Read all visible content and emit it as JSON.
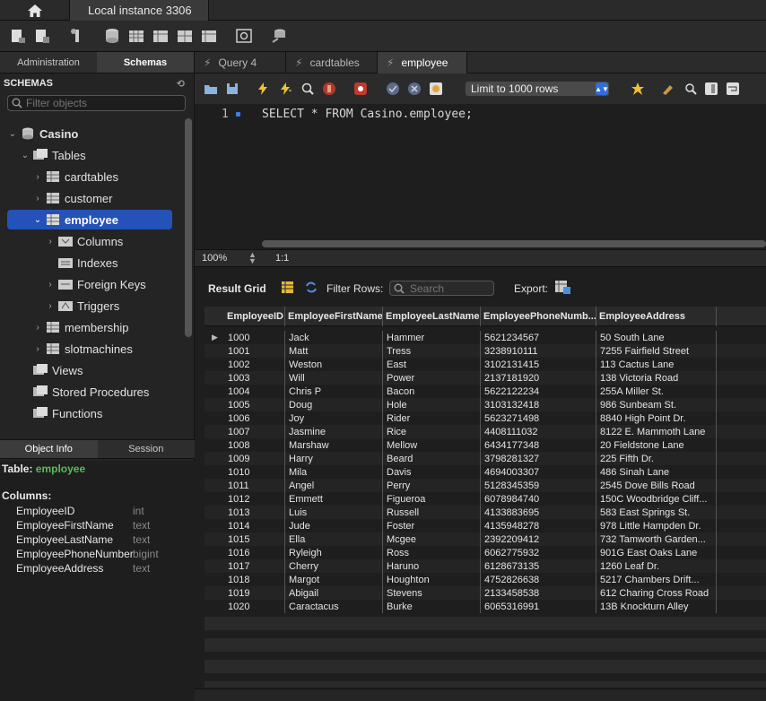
{
  "topbar": {
    "connection_tab": "Local instance 3306"
  },
  "sidebar": {
    "tabs": [
      "Administration",
      "Schemas"
    ],
    "active_tab": "Schemas",
    "header": "SCHEMAS",
    "filter_placeholder": "Filter objects",
    "tree": {
      "schema": "Casino",
      "tables_label": "Tables",
      "tables": [
        "cardtables",
        "customer",
        "employee"
      ],
      "selected_table": "employee",
      "employee_children": [
        "Columns",
        "Indexes",
        "Foreign Keys",
        "Triggers"
      ],
      "more_tables": [
        "membership",
        "slotmachines"
      ],
      "others": [
        "Views",
        "Stored Procedures",
        "Functions"
      ]
    },
    "info_tabs": [
      "Object Info",
      "Session"
    ],
    "object_info": {
      "table_label": "Table:",
      "table_name": "employee",
      "columns_label": "Columns:",
      "columns": [
        {
          "name": "EmployeeID",
          "type": "int"
        },
        {
          "name": "EmployeeFirstName",
          "type": "text"
        },
        {
          "name": "EmployeeLastName",
          "type": "text"
        },
        {
          "name": "EmployeePhoneNumber",
          "type": "bigint"
        },
        {
          "name": "EmployeeAddress",
          "type": "text"
        }
      ]
    }
  },
  "editor_tabs": [
    "Query 4",
    "cardtables",
    "employee"
  ],
  "active_editor_tab": "employee",
  "sql_toolbar": {
    "limit": "Limit to 1000 rows"
  },
  "editor": {
    "line": "1",
    "code": "SELECT * FROM Casino.employee;"
  },
  "status": {
    "zoom": "100%",
    "position": "1:1"
  },
  "result_toolbar": {
    "result_grid": "Result Grid",
    "filter_rows": "Filter Rows:",
    "search_placeholder": "Search",
    "export": "Export:"
  },
  "grid": {
    "columns": [
      "EmployeeID",
      "EmployeeFirstName",
      "EmployeeLastName",
      "EmployeePhoneNumb...",
      "EmployeeAddress"
    ],
    "rows": [
      [
        "1000",
        "Jack",
        "Hammer",
        "5621234567",
        "50 South Lane"
      ],
      [
        "1001",
        "Matt",
        "Tress",
        "3238910111",
        "7255 Fairfield Street"
      ],
      [
        "1002",
        "Weston",
        "East",
        "3102131415",
        "113 Cactus Lane"
      ],
      [
        "1003",
        "Will",
        "Power",
        "2137181920",
        "138 Victoria Road"
      ],
      [
        "1004",
        "Chris P",
        "Bacon",
        "5622122234",
        "255A Miller St."
      ],
      [
        "1005",
        "Doug",
        "Hole",
        "3103132418",
        "986 Sunbeam St."
      ],
      [
        "1006",
        "Joy",
        "Rider",
        "5623271498",
        "8840 High Point Dr."
      ],
      [
        "1007",
        "Jasmine",
        "Rice",
        "4408111032",
        "8122 E. Mammoth Lane"
      ],
      [
        "1008",
        "Marshaw",
        "Mellow",
        "6434177348",
        "20 Fieldstone Lane"
      ],
      [
        "1009",
        "Harry",
        "Beard",
        "3798281327",
        "225 Fifth Dr."
      ],
      [
        "1010",
        "Mila",
        "Davis",
        "4694003307",
        "486 Sinah Lane"
      ],
      [
        "1011",
        "Angel",
        "Perry",
        "5128345359",
        "2545 Dove Bills Road"
      ],
      [
        "1012",
        "Emmett",
        "Figueroa",
        "6078984740",
        "150C Woodbridge Cliff..."
      ],
      [
        "1013",
        "Luis",
        "Russell",
        "4133883695",
        "583 East Springs St."
      ],
      [
        "1014",
        "Jude",
        "Foster",
        "4135948278",
        "978 Little Hampden Dr."
      ],
      [
        "1015",
        "Ella",
        "Mcgee",
        "2392209412",
        "732 Tamworth Garden..."
      ],
      [
        "1016",
        "Ryleigh",
        "Ross",
        "6062775932",
        "901G East Oaks Lane"
      ],
      [
        "1017",
        "Cherry",
        "Haruno",
        "6128673135",
        "1260 Leaf Dr."
      ],
      [
        "1018",
        "Margot",
        "Houghton",
        "4752826638",
        "5217 Chambers Drift..."
      ],
      [
        "1019",
        "Abigail",
        "Stevens",
        "2133458538",
        "612 Charing Cross Road"
      ],
      [
        "1020",
        "Caractacus",
        "Burke",
        "6065316991",
        "13B Knockturn Alley"
      ]
    ]
  }
}
